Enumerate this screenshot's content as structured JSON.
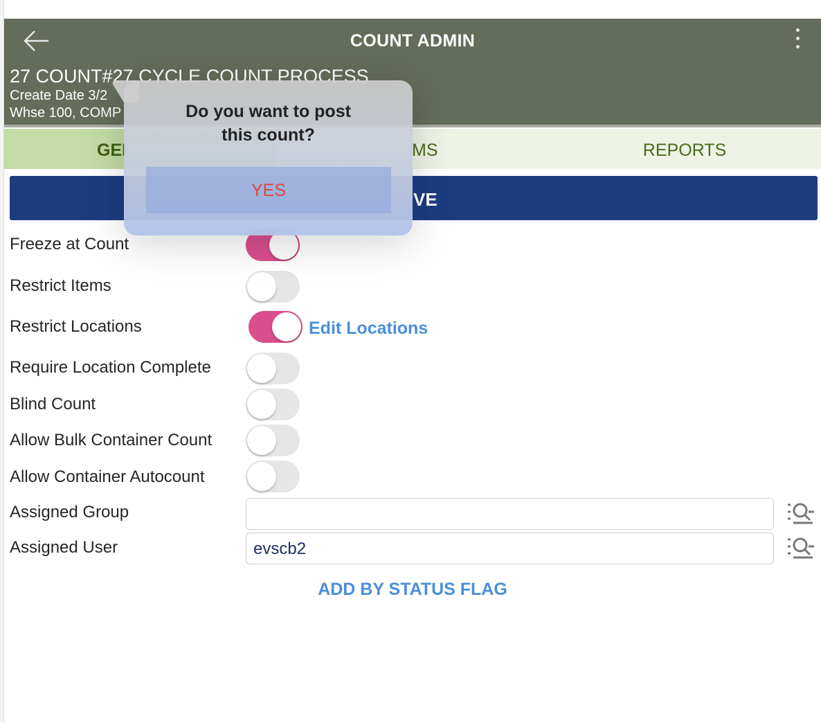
{
  "header": {
    "title": "COUNT ADMIN",
    "count_title": "27 COUNT#27 CYCLE COUNT PROCESS",
    "create_date": "Create Date 3/2",
    "whse": "Whse 100, COMP"
  },
  "tabs": [
    {
      "label": "GEI",
      "active": true
    },
    {
      "label": "MS",
      "active": false
    },
    {
      "label": "REPORTS",
      "active": false
    }
  ],
  "save_label": "VE",
  "settings": [
    {
      "label": "Freeze at Count",
      "on": true
    },
    {
      "label": "Restrict Items",
      "on": false
    },
    {
      "label": "Restrict Locations",
      "on": true
    },
    {
      "label": "Require Location Complete",
      "on": false
    },
    {
      "label": "Blind Count",
      "on": false
    },
    {
      "label": "Allow Bulk Container Count",
      "on": false
    },
    {
      "label": "Allow Container Autocount",
      "on": false
    }
  ],
  "edit_locations_label": "Edit Locations",
  "assigned_group": {
    "label": "Assigned Group",
    "value": ""
  },
  "assigned_user": {
    "label": "Assigned User",
    "value": "evscb2"
  },
  "add_by_status_flag": "ADD BY STATUS FLAG",
  "popover": {
    "line1": "Do you want to post",
    "line2": "this count?",
    "button": "YES"
  },
  "colors": {
    "header_bg": "#646c5b",
    "tab_active_bg": "#c3dba5",
    "save_bg": "#1d3c80",
    "toggle_on": "#d94f8c",
    "link": "#4a8fd9",
    "yes_text": "#e0453a"
  }
}
